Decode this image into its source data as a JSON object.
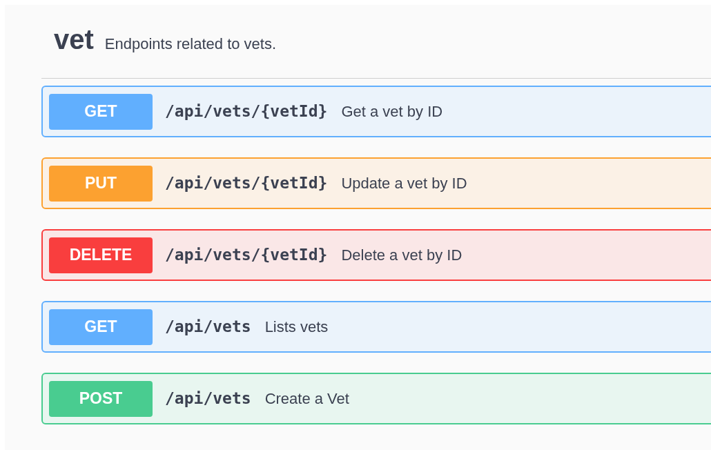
{
  "tag": {
    "name": "vet",
    "description": "Endpoints related to vets."
  },
  "operations": [
    {
      "kind": "get",
      "method": "GET",
      "path": "/api/vets/{vetId}",
      "summary": "Get a vet by ID"
    },
    {
      "kind": "put",
      "method": "PUT",
      "path": "/api/vets/{vetId}",
      "summary": "Update a vet by ID"
    },
    {
      "kind": "delete",
      "method": "DELETE",
      "path": "/api/vets/{vetId}",
      "summary": "Delete a vet by ID"
    },
    {
      "kind": "get",
      "method": "GET",
      "path": "/api/vets",
      "summary": "Lists vets"
    },
    {
      "kind": "post",
      "method": "POST",
      "path": "/api/vets",
      "summary": "Create a Vet"
    }
  ]
}
